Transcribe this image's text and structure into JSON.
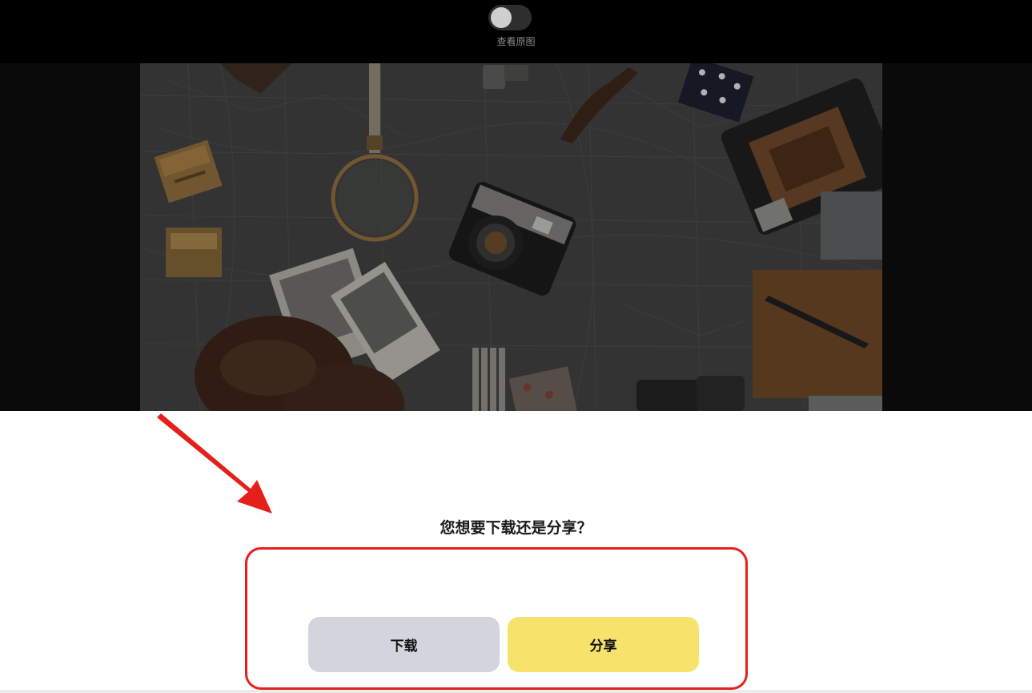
{
  "viewer": {
    "toggle_label": "查看原图",
    "toggle_on": false
  },
  "dialog": {
    "question": "您想要下载还是分享？",
    "download_label": "下载",
    "share_label": "分享"
  },
  "colors": {
    "download_button": "#d2d5dd",
    "share_button": "#f7e36b",
    "annotation": "#e5201a",
    "topbar": "#000000"
  },
  "icons": [
    "toggle-switch",
    "annotation-arrow"
  ]
}
